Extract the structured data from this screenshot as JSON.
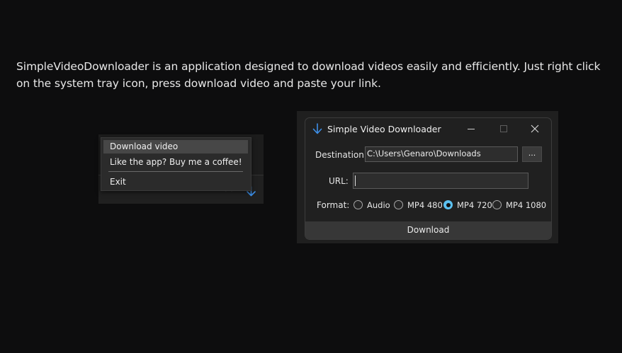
{
  "description": "SimpleVideoDownloader is an application designed to download videos easily and efficiently. Just right click on the system tray icon, press download video and paste your link.",
  "tray_menu": {
    "items": [
      {
        "label": "Download video"
      },
      {
        "label": "Like the app? Buy me a coffee!"
      },
      {
        "label": "Exit"
      }
    ],
    "tray_icon": "download-arrow-icon",
    "overflow_icon": "chevron-up-icon"
  },
  "app_window": {
    "title": "Simple Video Downloader",
    "title_icon": "download-arrow-icon",
    "destination": {
      "label": "Destination:",
      "value": "C:\\Users\\Genaro\\Downloads",
      "browse_label": "..."
    },
    "url": {
      "label": "URL:",
      "value": ""
    },
    "format": {
      "label": "Format:",
      "options": [
        {
          "label": "Audio",
          "selected": false
        },
        {
          "label": "MP4 480",
          "selected": false
        },
        {
          "label": "MP4 720",
          "selected": true
        },
        {
          "label": "MP4 1080",
          "selected": false
        }
      ]
    },
    "download_label": "Download",
    "colors": {
      "accent": "#5cc2f2",
      "icon_blue": "#3d8fe8"
    }
  }
}
